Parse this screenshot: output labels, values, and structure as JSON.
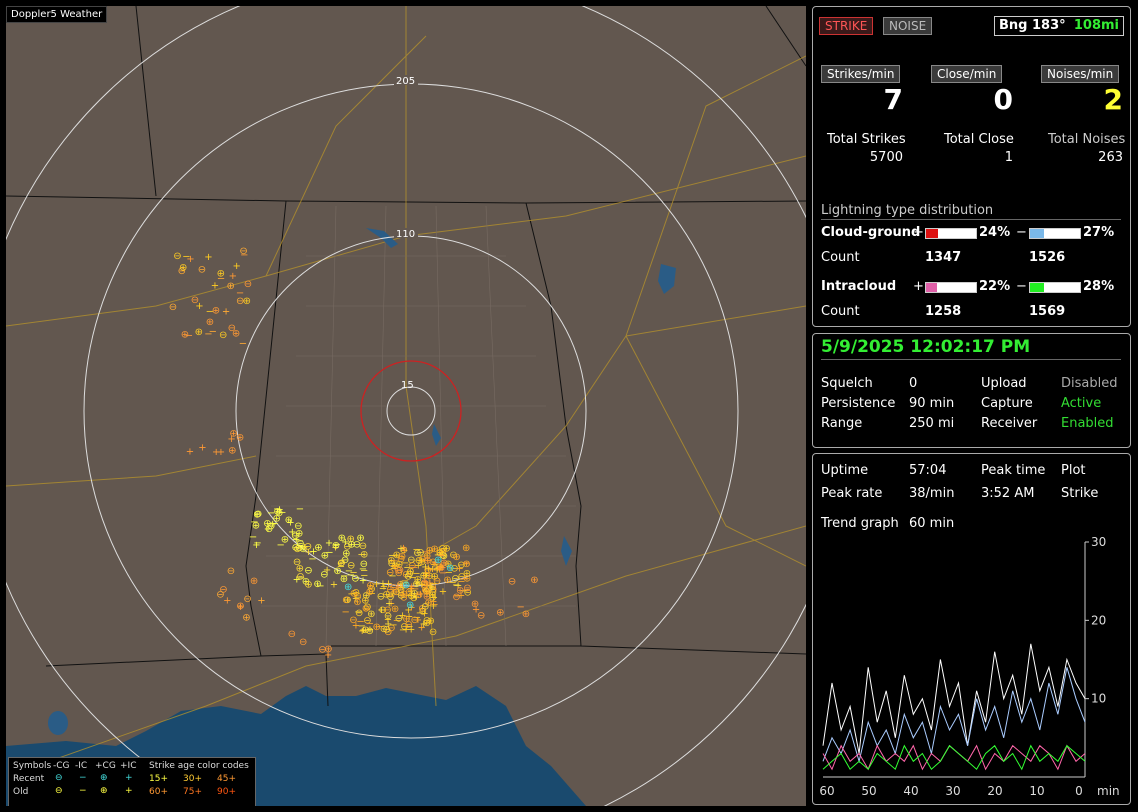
{
  "map": {
    "title": "Doppler5 Weather",
    "range_labels": [
      "205",
      "110",
      "15"
    ],
    "legend": {
      "symbols_label": "Symbols",
      "cols": [
        "-CG",
        "-IC",
        "+CG",
        "+IC"
      ],
      "age_label": "Strike age color codes",
      "recent_label": "Recent",
      "old_label": "Old",
      "recent_ages": [
        "15+",
        "30+",
        "45+"
      ],
      "old_ages": [
        "60+",
        "75+",
        "90+"
      ]
    }
  },
  "status": {
    "strike_label": "STRIKE",
    "noise_label": "NOISE",
    "bearing": "Bng 183°",
    "distance": "108mi",
    "rates": [
      {
        "label": "Strikes/min",
        "value": "7",
        "color": "#ffffff"
      },
      {
        "label": "Close/min",
        "value": "0",
        "color": "#ffffff"
      },
      {
        "label": "Noises/min",
        "value": "2",
        "color": "#ffff33"
      }
    ],
    "totals": [
      {
        "label": "Total Strikes",
        "value": "5700"
      },
      {
        "label": "Total Close",
        "value": "1"
      },
      {
        "label": "Total Noises",
        "value": "263"
      }
    ],
    "dist_title": "Lightning type distribution",
    "cg_label": "Cloud-ground",
    "ic_label": "Intracloud",
    "count_label": "Count",
    "plus": "+",
    "minus": "−",
    "cg_pos_pct": "24%",
    "cg_neg_pct": "27%",
    "cg_pos_count": "1347",
    "cg_neg_count": "1526",
    "ic_pos_pct": "22%",
    "ic_neg_pct": "28%",
    "ic_pos_count": "1258",
    "ic_neg_count": "1569",
    "cg_pos_frac": 0.24,
    "cg_neg_frac": 0.27,
    "ic_pos_frac": 0.22,
    "ic_neg_frac": 0.28
  },
  "settings": {
    "datetime": "5/9/2025 12:02:17 PM",
    "rows": [
      {
        "k1": "Squelch",
        "v1": "0",
        "k2": "Upload",
        "v2": "Disabled",
        "c2": "#aaaaaa"
      },
      {
        "k1": "Persistence",
        "v1": "90 min",
        "k2": "Capture",
        "v2": "Active",
        "c2": "#33dd33"
      },
      {
        "k1": "Range",
        "v1": "250 mi",
        "k2": "Receiver",
        "v2": "Enabled",
        "c2": "#33dd33"
      }
    ]
  },
  "stats": {
    "uptime_label": "Uptime",
    "uptime": "57:04",
    "peak_time_label": "Peak time",
    "peak_time": "3:52 AM",
    "plot_label": "Plot",
    "plot": "Strike",
    "peak_rate_label": "Peak rate",
    "peak_rate": "38/min",
    "trend_label": "Trend graph",
    "trend": "60 min"
  },
  "chart_data": {
    "type": "line",
    "xlabel": "min",
    "x_ticks": [
      "60",
      "50",
      "40",
      "30",
      "20",
      "10",
      "0"
    ],
    "y_ticks": [
      "30",
      "20",
      "10"
    ],
    "ylim": [
      0,
      30
    ],
    "xlim": [
      60,
      0
    ],
    "series": [
      {
        "color": "#ffffff",
        "values": [
          4,
          12,
          6,
          9,
          3,
          14,
          7,
          11,
          5,
          13,
          8,
          10,
          6,
          15,
          9,
          12,
          4,
          11,
          7,
          16,
          10,
          13,
          8,
          17,
          11,
          14,
          9,
          15,
          12,
          10
        ]
      },
      {
        "color": "#aaccff",
        "values": [
          2,
          5,
          3,
          6,
          2,
          7,
          4,
          6,
          3,
          8,
          5,
          7,
          3,
          9,
          6,
          8,
          4,
          10,
          6,
          9,
          5,
          11,
          7,
          10,
          6,
          12,
          8,
          14,
          10,
          7
        ]
      },
      {
        "color": "#ff66aa",
        "values": [
          3,
          1,
          4,
          2,
          3,
          1,
          4,
          2,
          3,
          2,
          4,
          1,
          3,
          2,
          4,
          3,
          2,
          4,
          1,
          3,
          2,
          4,
          3,
          2,
          4,
          3,
          1,
          4,
          2,
          3
        ]
      },
      {
        "color": "#33ff33",
        "values": [
          1,
          2,
          3,
          1,
          2,
          1,
          3,
          2,
          1,
          4,
          2,
          3,
          1,
          2,
          4,
          3,
          2,
          1,
          3,
          4,
          2,
          3,
          1,
          4,
          2,
          3,
          2,
          4,
          3,
          2
        ]
      }
    ]
  }
}
